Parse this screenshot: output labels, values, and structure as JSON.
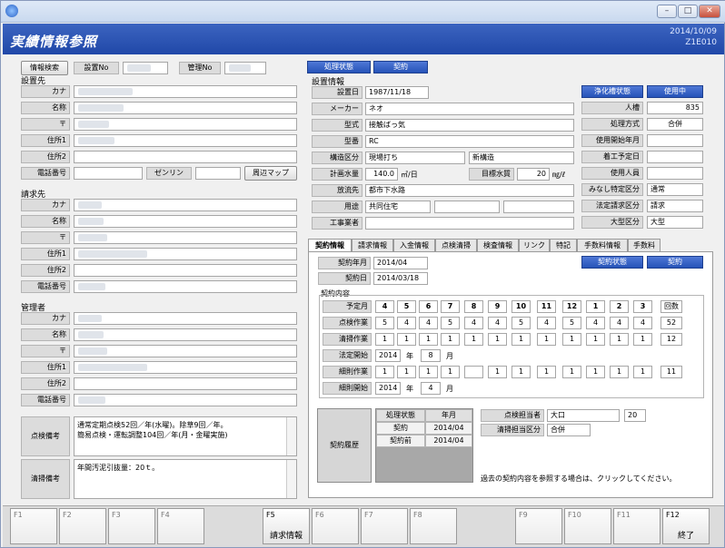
{
  "screen": {
    "title": "実績情報参照",
    "date": "2014/10/09",
    "code": "Z1E010"
  },
  "top": {
    "info_search": "情報検索",
    "equip_no_label": "設置No",
    "mgmt_no_label": "管理No",
    "status_tab": "処理状態",
    "contract_tab": "契約"
  },
  "install_site": {
    "section": "設置先",
    "kana": "カナ",
    "name": "名称",
    "zip": "〒",
    "addr1": "住所1",
    "addr2": "住所2",
    "phone": "電話番号",
    "zenrin": "ゼンリン",
    "map_btn": "周辺マップ"
  },
  "billing": {
    "section": "請求先",
    "kana": "カナ",
    "name": "名称",
    "zip": "〒",
    "addr1": "住所1",
    "addr2": "住所2",
    "phone": "電話番号"
  },
  "manager": {
    "section": "管理者",
    "kana": "カナ",
    "name": "名称",
    "zip": "〒",
    "addr1": "住所1",
    "addr2": "住所2",
    "phone": "電話番号"
  },
  "notes": {
    "inspection_label": "点検備考",
    "inspection_text": "通常定期点検52回／年(水曜)。除草9回／年。\n簡易点検・運転調整104回／年(月・金曜実施)",
    "cleaning_label": "清掃備考",
    "cleaning_text": "年間汚泥引抜量：20ｔ。"
  },
  "equipment": {
    "section": "設置情報",
    "install_date_label": "設置日",
    "install_date": "1987/11/18",
    "maker_label": "メーカー",
    "maker": "ネオ",
    "model_label": "型式",
    "model": "接触ばっ気",
    "type_label": "型番",
    "type": "RC",
    "structure_label": "構造区分",
    "structure": "現場打ち",
    "structure2": "新構造",
    "plan_water_label": "計画水量",
    "plan_water": "140.0",
    "plan_water_unit": "㎥/日",
    "target_label": "目標水質",
    "target": "20",
    "target_unit": "㎎/ℓ",
    "discharge_label": "放流先",
    "discharge": "都市下水路",
    "usage_label": "用途",
    "usage": "共同住宅",
    "contractor_label": "工事業者",
    "tank_status_btn": "浄化槽状態",
    "in_use_btn": "使用中",
    "persons_label": "人槽",
    "persons": "835",
    "method_label": "処理方式",
    "method": "合併",
    "start_label": "使用開始年月",
    "construction_label": "着工予定日",
    "users_label": "使用人員",
    "deemed_label": "みなし特定区分",
    "deemed": "通常",
    "legal_label": "法定請求区分",
    "legal": "請求",
    "size_label": "大型区分",
    "size": "大型"
  },
  "tabs": [
    "契約情報",
    "請求情報",
    "入金情報",
    "点検清掃",
    "検査情報",
    "リンク",
    "特記",
    "手数料情報",
    "手数料"
  ],
  "contract": {
    "year_month_label": "契約年月",
    "year_month": "2014/04",
    "date_label": "契約日",
    "date": "2014/03/18",
    "status_btn": "契約状態",
    "contract_btn": "契約",
    "content_label": "契約内容",
    "schedule_label": "予定月",
    "months": [
      "4",
      "5",
      "6",
      "7",
      "8",
      "9",
      "10",
      "11",
      "12",
      "1",
      "2",
      "3"
    ],
    "count_label": "回数",
    "inspection_label": "点検作業",
    "inspection_counts": [
      "5",
      "4",
      "4",
      "5",
      "4",
      "4",
      "5",
      "4",
      "5",
      "4",
      "4",
      "4"
    ],
    "inspection_total": "52",
    "cleaning_label": "清掃作業",
    "cleaning_counts": [
      "1",
      "1",
      "1",
      "1",
      "1",
      "1",
      "1",
      "1",
      "1",
      "1",
      "1",
      "1"
    ],
    "cleaning_total": "12",
    "legal_start_label": "法定開始",
    "legal_start_year": "2014",
    "legal_start_month": "8",
    "year_char": "年",
    "month_char": "月",
    "weeding_label": "細則作業",
    "weeding_counts": [
      "1",
      "1",
      "1",
      "1",
      "",
      "1",
      "1",
      "1",
      "1",
      "1",
      "1",
      "1"
    ],
    "weeding_total": "11",
    "weeding_start_label": "細則開始",
    "weeding_start_year": "2014",
    "weeding_start_month": "4"
  },
  "history": {
    "label": "契約履歴",
    "col_status": "処理状態",
    "col_ym": "年月",
    "rows": [
      {
        "status": "契約",
        "ym": "2014/04"
      },
      {
        "status": "契約前",
        "ym": "2014/04"
      }
    ],
    "inspector_label": "点検担当者",
    "inspector": "大口",
    "inspector_code": "20",
    "cleaning_label": "清掃担当区分",
    "cleaning": "合併",
    "hint": "過去の契約内容を参照する場合は、クリックしてください。"
  },
  "fkeys": [
    {
      "key": "F1",
      "label": ""
    },
    {
      "key": "F2",
      "label": ""
    },
    {
      "key": "F3",
      "label": ""
    },
    {
      "key": "F4",
      "label": ""
    },
    {
      "key": "F5",
      "label": "請求情報"
    },
    {
      "key": "F6",
      "label": ""
    },
    {
      "key": "F7",
      "label": ""
    },
    {
      "key": "F8",
      "label": ""
    },
    {
      "key": "F9",
      "label": ""
    },
    {
      "key": "F10",
      "label": ""
    },
    {
      "key": "F11",
      "label": ""
    },
    {
      "key": "F12",
      "label": "終了"
    }
  ],
  "colors": {
    "banner": "#2a52b0",
    "button_blue": "#2f5cc4",
    "label_gray": "#dcdcdc"
  }
}
